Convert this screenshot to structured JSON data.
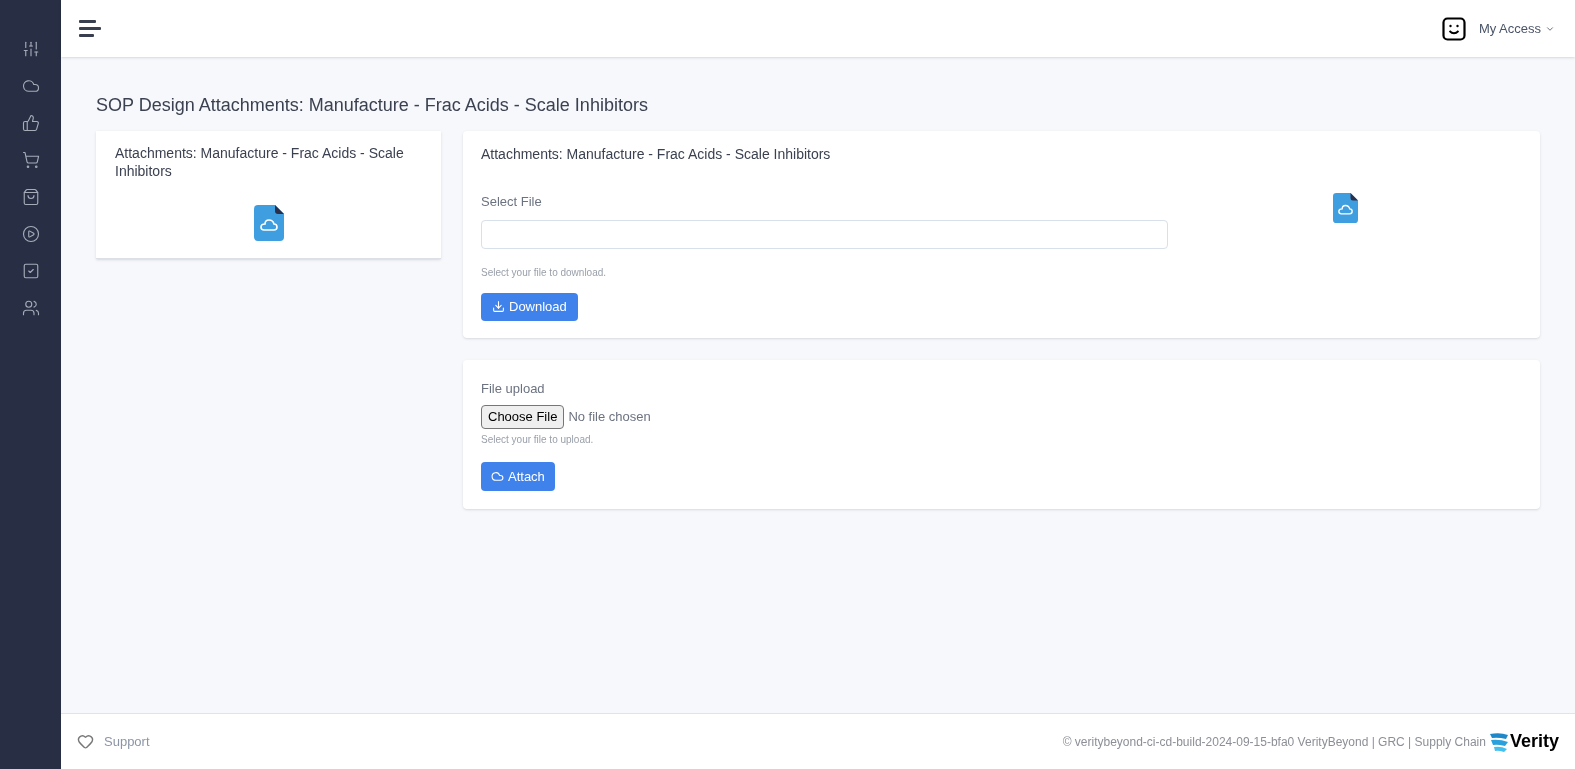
{
  "header": {
    "user_menu": "My Access"
  },
  "page_title": "SOP Design Attachments: Manufacture - Frac Acids - Scale Inhibitors",
  "summary_card": {
    "title": "Attachments: Manufacture - Frac Acids - Scale Inhibitors"
  },
  "download_card": {
    "title": "Attachments: Manufacture - Frac Acids - Scale Inhibitors",
    "label": "Select File",
    "help": "Select your file to download.",
    "button": "Download"
  },
  "upload_card": {
    "label": "File upload",
    "choose_button": "Choose File",
    "file_status": "No file chosen",
    "help": "Select your file to upload.",
    "button": "Attach"
  },
  "footer": {
    "support": "Support",
    "copyright": "© veritybeyond-ci-cd-build-2024-09-15-bfa0 VerityBeyond | GRC | Supply Chain",
    "logo_text": "Verity"
  }
}
